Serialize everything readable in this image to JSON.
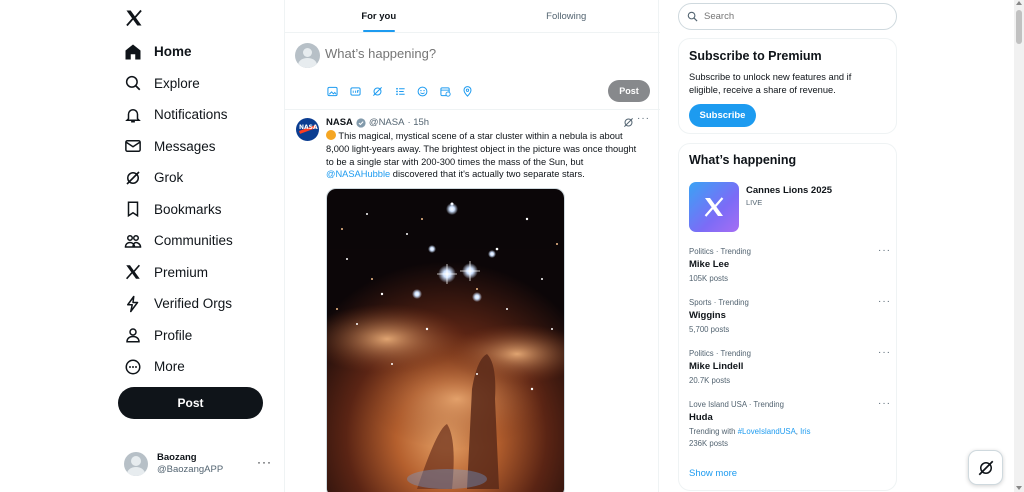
{
  "nav": {
    "items": [
      {
        "label": "Home",
        "icon": "home-icon"
      },
      {
        "label": "Explore",
        "icon": "search-icon"
      },
      {
        "label": "Notifications",
        "icon": "bell-icon"
      },
      {
        "label": "Messages",
        "icon": "envelope-icon"
      },
      {
        "label": "Grok",
        "icon": "grok-icon"
      },
      {
        "label": "Bookmarks",
        "icon": "bookmark-icon"
      },
      {
        "label": "Communities",
        "icon": "people-icon"
      },
      {
        "label": "Premium",
        "icon": "x-icon"
      },
      {
        "label": "Verified Orgs",
        "icon": "lightning-icon"
      },
      {
        "label": "Profile",
        "icon": "person-icon"
      },
      {
        "label": "More",
        "icon": "more-circle-icon"
      }
    ],
    "post_label": "Post"
  },
  "account": {
    "name": "Baozang",
    "handle": "@BaozangAPP",
    "more": "···"
  },
  "feed": {
    "tabs": [
      {
        "label": "For you"
      },
      {
        "label": "Following"
      }
    ],
    "compose": {
      "placeholder": "What’s happening?",
      "post_label": "Post"
    }
  },
  "tweet": {
    "name": "NASA",
    "handle": "@NASA",
    "time": "· 15h",
    "more": "···",
    "text_before": " This magical, mystical scene of a star cluster within a nebula is about 8,000 light-years away. The brightest object in the picture was once thought to be a single star with 200-300 times the mass of the Sun, but ",
    "mention": "@NASAHubble",
    "text_after": " discovered that it's actually two separate stars.",
    "avatar_text": "NASA"
  },
  "sidebar": {
    "search_placeholder": "Search",
    "premium": {
      "title": "Subscribe to Premium",
      "text": "Subscribe to unlock new features and if eligible, receive a share of revenue.",
      "button": "Subscribe"
    },
    "happening": {
      "title": "What’s happening",
      "live": {
        "title": "Cannes Lions 2025",
        "status": "LIVE"
      },
      "trends": [
        {
          "meta": "Politics · Trending",
          "name": "Mike Lee",
          "posts": "105K posts",
          "more": "···"
        },
        {
          "meta": "Sports · Trending",
          "name": "Wiggins",
          "posts": "5,700 posts",
          "more": "···"
        },
        {
          "meta": "Politics · Trending",
          "name": "Mike Lindell",
          "posts": "20.7K posts",
          "more": "···"
        },
        {
          "meta": "Love Island USA · Trending",
          "name": "Huda",
          "trending_with_prefix": "Trending with ",
          "trending_with_tag": "#LoveIslandUSA",
          "trending_with_sep": ", ",
          "trending_with_tag2": "Iris",
          "posts": "236K posts",
          "more": "···"
        }
      ],
      "show_more": "Show more"
    }
  },
  "colors": {
    "accent": "#1d9bf0",
    "text": "#0f1419",
    "muted": "#536471",
    "post_button": "#0f1419"
  }
}
